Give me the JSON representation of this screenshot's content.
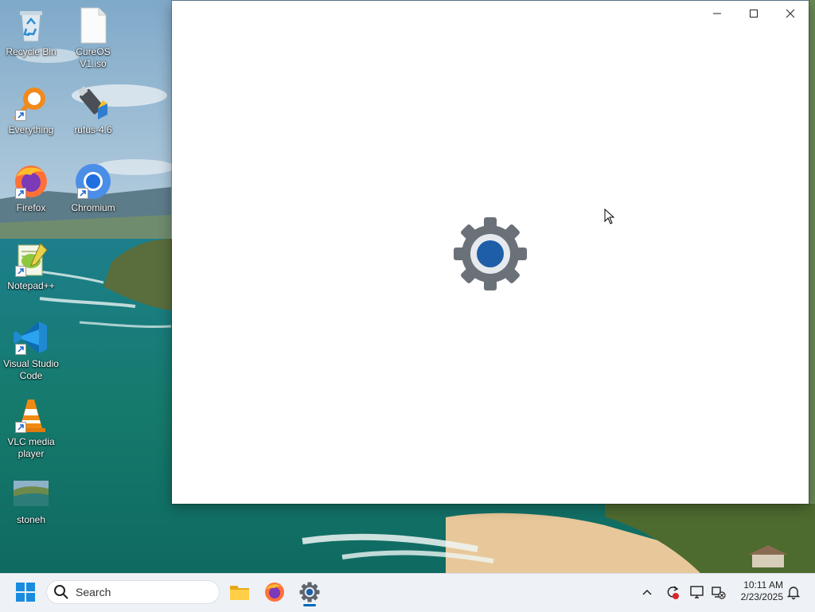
{
  "desktop": {
    "icons": [
      {
        "label": "Recycle Bin",
        "icon": "recycle-bin-icon",
        "shortcut": false
      },
      {
        "label": "CureOS V1.iso",
        "icon": "file-icon",
        "shortcut": false
      },
      {
        "label": "Everything",
        "icon": "everything-search-icon",
        "shortcut": true
      },
      {
        "label": "rufus-4.6",
        "icon": "usb-drive-icon",
        "shortcut": false
      },
      {
        "label": "Firefox",
        "icon": "firefox-icon",
        "shortcut": true
      },
      {
        "label": "Chromium",
        "icon": "chromium-icon",
        "shortcut": true
      },
      {
        "label": "Notepad++",
        "icon": "notepad-plus-plus-icon",
        "shortcut": true
      },
      {
        "label": "Visual Studio Code",
        "icon": "vscode-icon",
        "shortcut": true
      },
      {
        "label": "VLC media player",
        "icon": "vlc-icon",
        "shortcut": true
      },
      {
        "label": "stoneh",
        "icon": "image-thumbnail-icon",
        "shortcut": false
      }
    ]
  },
  "window": {
    "app_icon": "settings-gear-icon",
    "controls": {
      "minimize": "minimize-icon",
      "maximize": "maximize-icon",
      "close": "close-icon"
    },
    "background": "#ffffff",
    "gear_color": "#6b7178",
    "accent": "#1e5ea8"
  },
  "taskbar": {
    "search_placeholder": "Search",
    "pinned": [
      "windows-start-icon",
      "file-explorer-icon",
      "firefox-icon",
      "settings-gear-icon"
    ],
    "active_app": "settings-gear-icon",
    "tray": [
      "chevron-up-icon",
      "sync-icon",
      "display-icon",
      "network-off-icon",
      "notification-bell-icon"
    ],
    "time": "10:11 AM",
    "date": "2/23/2025",
    "accent": "#0067c0"
  }
}
